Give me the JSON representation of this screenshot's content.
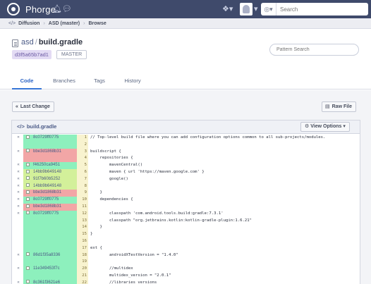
{
  "topbar": {
    "app_name": "Phorge",
    "search_placeholder": "Search"
  },
  "breadcrumb": {
    "items": [
      "Diffusion",
      "ASD (master)",
      "Browse"
    ]
  },
  "header": {
    "repo": "asd",
    "file": "build.gradle",
    "commit": "d3f5a65b7ad1",
    "branch": "MASTER",
    "pattern_placeholder": "Pattern Search"
  },
  "tabs": [
    "Code",
    "Branches",
    "Tags",
    "History"
  ],
  "actions": {
    "last_change": "Last Change",
    "raw_file": "Raw File",
    "view_options": "View Options"
  },
  "panel": {
    "title": "build.gradle"
  },
  "colors": {
    "topbar": "#3f4a6b",
    "blame_green": "#8df0bd",
    "blame_red": "#f2a6a6",
    "blame_yellowgreen": "#d3f09a",
    "link": "#2b63c5"
  },
  "lines": [
    {
      "n": "1",
      "hash": "8c0729ff0775",
      "arrow": true,
      "color": "#8df0bd",
      "code": "// Top-level build file where you can add configuration options common to all sub-projects/modules."
    },
    {
      "n": "2",
      "hash": "",
      "arrow": false,
      "color": "#8df0bd",
      "code": ""
    },
    {
      "n": "3",
      "hash": "bbe3d1868b31",
      "arrow": true,
      "color": "#f2a6a6",
      "code": "buildscript {"
    },
    {
      "n": "4",
      "hash": "",
      "arrow": false,
      "color": "#f2a6a6",
      "code": "    repositories {"
    },
    {
      "n": "5",
      "hash": "f46250ca9451",
      "arrow": true,
      "color": "#8df0bd",
      "code": "        mavenCentral()"
    },
    {
      "n": "6",
      "hash": "14bb9b649148",
      "arrow": true,
      "color": "#d3f09a",
      "code": "        maven { url 'https://maven.google.com' }"
    },
    {
      "n": "7",
      "hash": "91f7b60b5252",
      "arrow": true,
      "color": "#d3f09a",
      "code": "        google()"
    },
    {
      "n": "8",
      "hash": "14bb9b649148",
      "arrow": true,
      "color": "#d3f09a",
      "code": ""
    },
    {
      "n": "9",
      "hash": "bbe3d1868b31",
      "arrow": true,
      "color": "#f2a6a6",
      "code": "    }"
    },
    {
      "n": "10",
      "hash": "8c0729ff0775",
      "arrow": true,
      "color": "#8df0bd",
      "code": "    dependencies {"
    },
    {
      "n": "11",
      "hash": "bbe3d1868b31",
      "arrow": true,
      "color": "#f2a6a6",
      "code": ""
    },
    {
      "n": "12",
      "hash": "8c0729ff0775",
      "arrow": true,
      "color": "#8df0bd",
      "code": "        classpath 'com.android.tools.build:gradle:7.3.1'"
    },
    {
      "n": "13",
      "hash": "",
      "arrow": false,
      "color": "#8df0bd",
      "code": "        classpath \"org.jetbrains.kotlin:kotlin-gradle-plugin:1.6.21\""
    },
    {
      "n": "14",
      "hash": "",
      "arrow": false,
      "color": "#8df0bd",
      "code": "    }"
    },
    {
      "n": "15",
      "hash": "",
      "arrow": false,
      "color": "#8df0bd",
      "code": "}"
    },
    {
      "n": "16",
      "hash": "",
      "arrow": false,
      "color": "#8df0bd",
      "code": ""
    },
    {
      "n": "17",
      "hash": "",
      "arrow": false,
      "color": "#8df0bd",
      "code": "ext {"
    },
    {
      "n": "18",
      "hash": "86d1f35a8336",
      "arrow": true,
      "color": "#8df0bd",
      "code": "        androidXTestVersion = \"1.4.0\""
    },
    {
      "n": "19",
      "hash": "",
      "arrow": false,
      "color": "#8df0bd",
      "code": ""
    },
    {
      "n": "20",
      "hash": "11e349453f7c",
      "arrow": true,
      "color": "#8df0bd",
      "code": "        //multidex"
    },
    {
      "n": "21",
      "hash": "",
      "arrow": false,
      "color": "#8df0bd",
      "code": "        multidex_version = \"2.0.1\""
    },
    {
      "n": "22",
      "hash": "8c361f3621e6",
      "arrow": true,
      "color": "#8df0bd",
      "code": "        //libraries versions"
    }
  ]
}
